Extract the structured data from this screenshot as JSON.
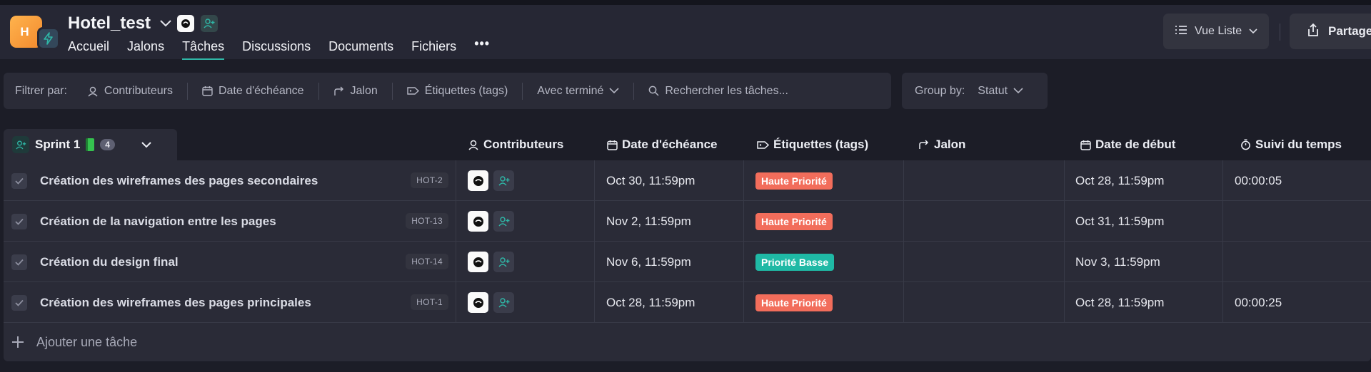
{
  "header": {
    "avatar_letter": "H",
    "project_title": "Hotel_test",
    "tabs": [
      {
        "label": "Accueil"
      },
      {
        "label": "Jalons"
      },
      {
        "label": "Tâches"
      },
      {
        "label": "Discussions"
      },
      {
        "label": "Documents"
      },
      {
        "label": "Fichiers"
      },
      {
        "label": "•••"
      }
    ],
    "active_tab": "Tâches",
    "view_button": "Vue Liste",
    "share_button": "Partager"
  },
  "filters": {
    "label": "Filtrer par:",
    "items": [
      "Contributeurs",
      "Date d'échéance",
      "Jalon",
      "Étiquettes (tags)",
      "Avec terminé"
    ],
    "search_placeholder": "Rechercher les tâches..."
  },
  "group_by": {
    "label": "Group by:",
    "value": "Statut"
  },
  "sprint": {
    "name": "Sprint 1",
    "count": "4"
  },
  "columns": {
    "contributors": "Contributeurs",
    "due_date": "Date d'échéance",
    "tags": "Étiquettes (tags)",
    "milestone": "Jalon",
    "start_date": "Date de début",
    "time_tracking": "Suivi du temps"
  },
  "tasks": [
    {
      "name": "Création des wireframes des pages secondaires",
      "code": "HOT-2",
      "due": "Oct 30, 11:59pm",
      "tag": "Haute Priorité",
      "tag_color": "#f26d5b",
      "start": "Oct 28, 11:59pm",
      "time": "00:00:05"
    },
    {
      "name": "Création de la navigation entre les pages",
      "code": "HOT-13",
      "due": "Nov 2, 11:59pm",
      "tag": "Haute Priorité",
      "tag_color": "#f26d5b",
      "start": "Oct 31, 11:59pm",
      "time": ""
    },
    {
      "name": "Création du design final",
      "code": "HOT-14",
      "due": "Nov 6, 11:59pm",
      "tag": "Priorité Basse",
      "tag_color": "#1fb9a5",
      "start": "Nov 3, 11:59pm",
      "time": ""
    },
    {
      "name": "Création des wireframes des pages principales",
      "code": "HOT-1",
      "due": "Oct 28, 11:59pm",
      "tag": "Haute Priorité",
      "tag_color": "#f26d5b",
      "start": "Oct 28, 11:59pm",
      "time": "00:00:25"
    }
  ],
  "add_task_label": "Ajouter une tâche",
  "colors": {
    "accent": "#2fb6a6",
    "avatar": "#f7962f",
    "high_priority": "#f26d5b",
    "low_priority": "#1fb9a5"
  }
}
